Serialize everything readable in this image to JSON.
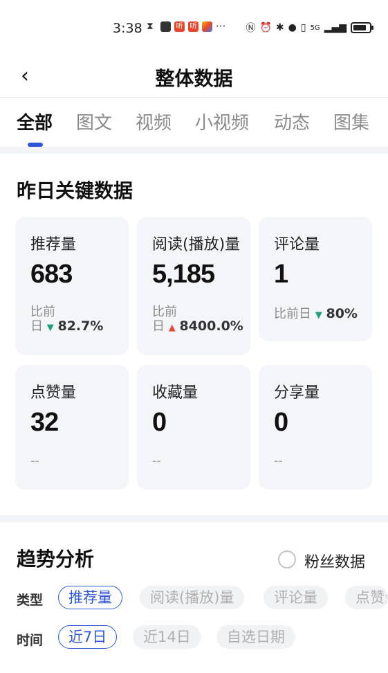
{
  "status_bar": {
    "time": "3:38",
    "more": "···",
    "red_app_text_1": "听",
    "red_app_text_2": "听",
    "right_icons": "N ⦸ ✱ ◉ ▯ 5G ıll",
    "network_label": "5G"
  },
  "header": {
    "back": "‹",
    "title": "整体数据"
  },
  "tabs": [
    {
      "label": "全部",
      "active": true
    },
    {
      "label": "图文",
      "active": false
    },
    {
      "label": "视频",
      "active": false
    },
    {
      "label": "小视频",
      "active": false
    },
    {
      "label": "动态",
      "active": false
    },
    {
      "label": "图集",
      "active": false
    }
  ],
  "key_data": {
    "title": "昨日关键数据",
    "cards": [
      {
        "label": "推荐量",
        "value": "683",
        "compare_line1": "比前",
        "compare_line2": "日",
        "direction": "down",
        "arrow": "▼",
        "change": "82.7%"
      },
      {
        "label": "阅读(播放)量",
        "value": "5,185",
        "compare_line1": "比前",
        "compare_line2": "日",
        "direction": "up",
        "arrow": "▲",
        "change": "8400.0%"
      },
      {
        "label": "评论量",
        "value": "1",
        "compare_line1": "比前日",
        "compare_line2": "",
        "direction": "down",
        "arrow": "▼",
        "change": "80%"
      },
      {
        "label": "点赞量",
        "value": "32",
        "empty": "--"
      },
      {
        "label": "收藏量",
        "value": "0",
        "empty": "--"
      },
      {
        "label": "分享量",
        "value": "0",
        "empty": "--"
      }
    ]
  },
  "trend": {
    "title": "趋势分析",
    "fans_toggle_label": "粉丝数据",
    "fans_toggle_checked": false,
    "type_label": "类型",
    "type_chips": [
      {
        "label": "推荐量",
        "active": true
      },
      {
        "label": "阅读(播放)量",
        "active": false
      },
      {
        "label": "评论量",
        "active": false
      },
      {
        "label": "点赞量",
        "active": false
      }
    ],
    "time_label": "时间",
    "time_chips": [
      {
        "label": "近7日",
        "active": true
      },
      {
        "label": "近14日",
        "active": false
      },
      {
        "label": "自选日期",
        "active": false
      }
    ]
  },
  "colors": {
    "accent": "#2f56d9",
    "down": "#1aa37a",
    "up": "#e64a3c",
    "card_bg": "#f4f5f8"
  }
}
